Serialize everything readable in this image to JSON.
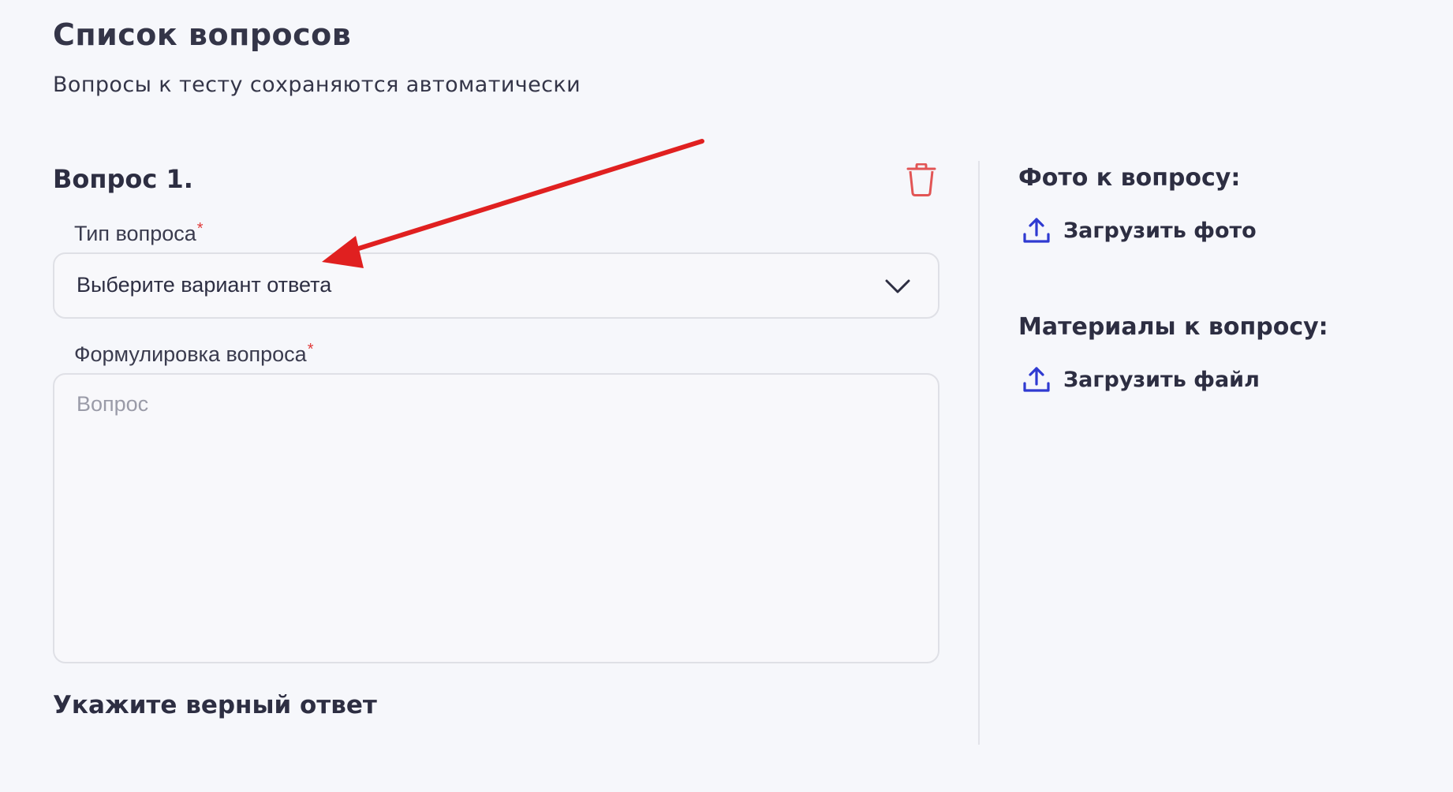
{
  "page": {
    "title": "Список вопросов",
    "subtitle": "Вопросы к тесту сохраняются автоматически"
  },
  "question": {
    "heading": "Вопрос 1.",
    "type_label": "Тип вопроса",
    "type_required_mark": "*",
    "type_value": "Выберите вариант ответа",
    "text_label": "Формулировка вопроса",
    "text_required_mark": "*",
    "text_placeholder": "Вопрос",
    "answer_heading": "Укажите верный ответ"
  },
  "sidebar": {
    "photo_heading": "Фото к вопросу:",
    "photo_upload_label": "Загрузить фото",
    "materials_heading": "Материалы к вопросу:",
    "file_upload_label": "Загрузить файл"
  },
  "icons": {
    "delete": "trash-icon",
    "dropdown": "chevron-down-icon",
    "upload": "upload-icon",
    "annotation": "red-arrow"
  },
  "colors": {
    "background": "#f6f7fb",
    "delete_icon": "#e25555",
    "upload_icon": "#2f3ad1",
    "required_mark": "#e03a3a",
    "annotation_arrow": "#e02020"
  }
}
